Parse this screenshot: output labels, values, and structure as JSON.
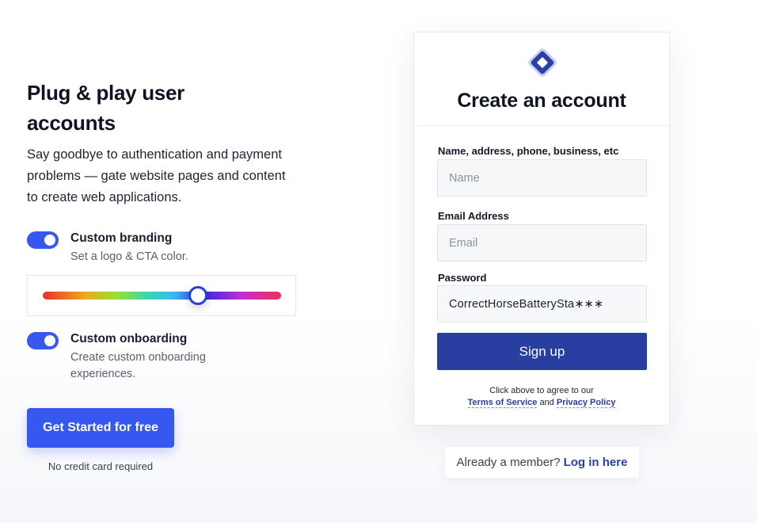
{
  "hero": {
    "headline": "Plug & play user accounts",
    "subtext": "Say goodbye to authentication and payment problems — gate website pages and content to create web applications."
  },
  "features": [
    {
      "title": "Custom branding",
      "description": "Set a logo & CTA color.",
      "enabled": true
    },
    {
      "title": "Custom onboarding",
      "description": "Create custom onboarding experiences.",
      "enabled": true
    }
  ],
  "color_slider": {
    "value_fraction": 0.65
  },
  "cta": {
    "label": "Get Started for free",
    "note": "No credit card required"
  },
  "signup_form": {
    "title": "Create an account",
    "fields": [
      {
        "label": "Name, address, phone, business, etc",
        "placeholder": "Name",
        "value": ""
      },
      {
        "label": "Email Address",
        "placeholder": "Email",
        "value": ""
      },
      {
        "label": "Password",
        "placeholder": "",
        "value": "CorrectHorseBatterySta∗∗∗"
      }
    ],
    "submit_label": "Sign up",
    "legal_prefix": "Click above to agree to our",
    "terms_label": "Terms of Service",
    "legal_and": "and",
    "privacy_label": "Privacy Policy"
  },
  "login_prompt": {
    "text": "Already a member?",
    "link_label": "Log in here"
  },
  "colors": {
    "accent": "#3658f0",
    "primary_dark": "#283ea0",
    "link": "#2a3f9e"
  },
  "icons": {
    "logo": "diamond-logo-icon"
  }
}
